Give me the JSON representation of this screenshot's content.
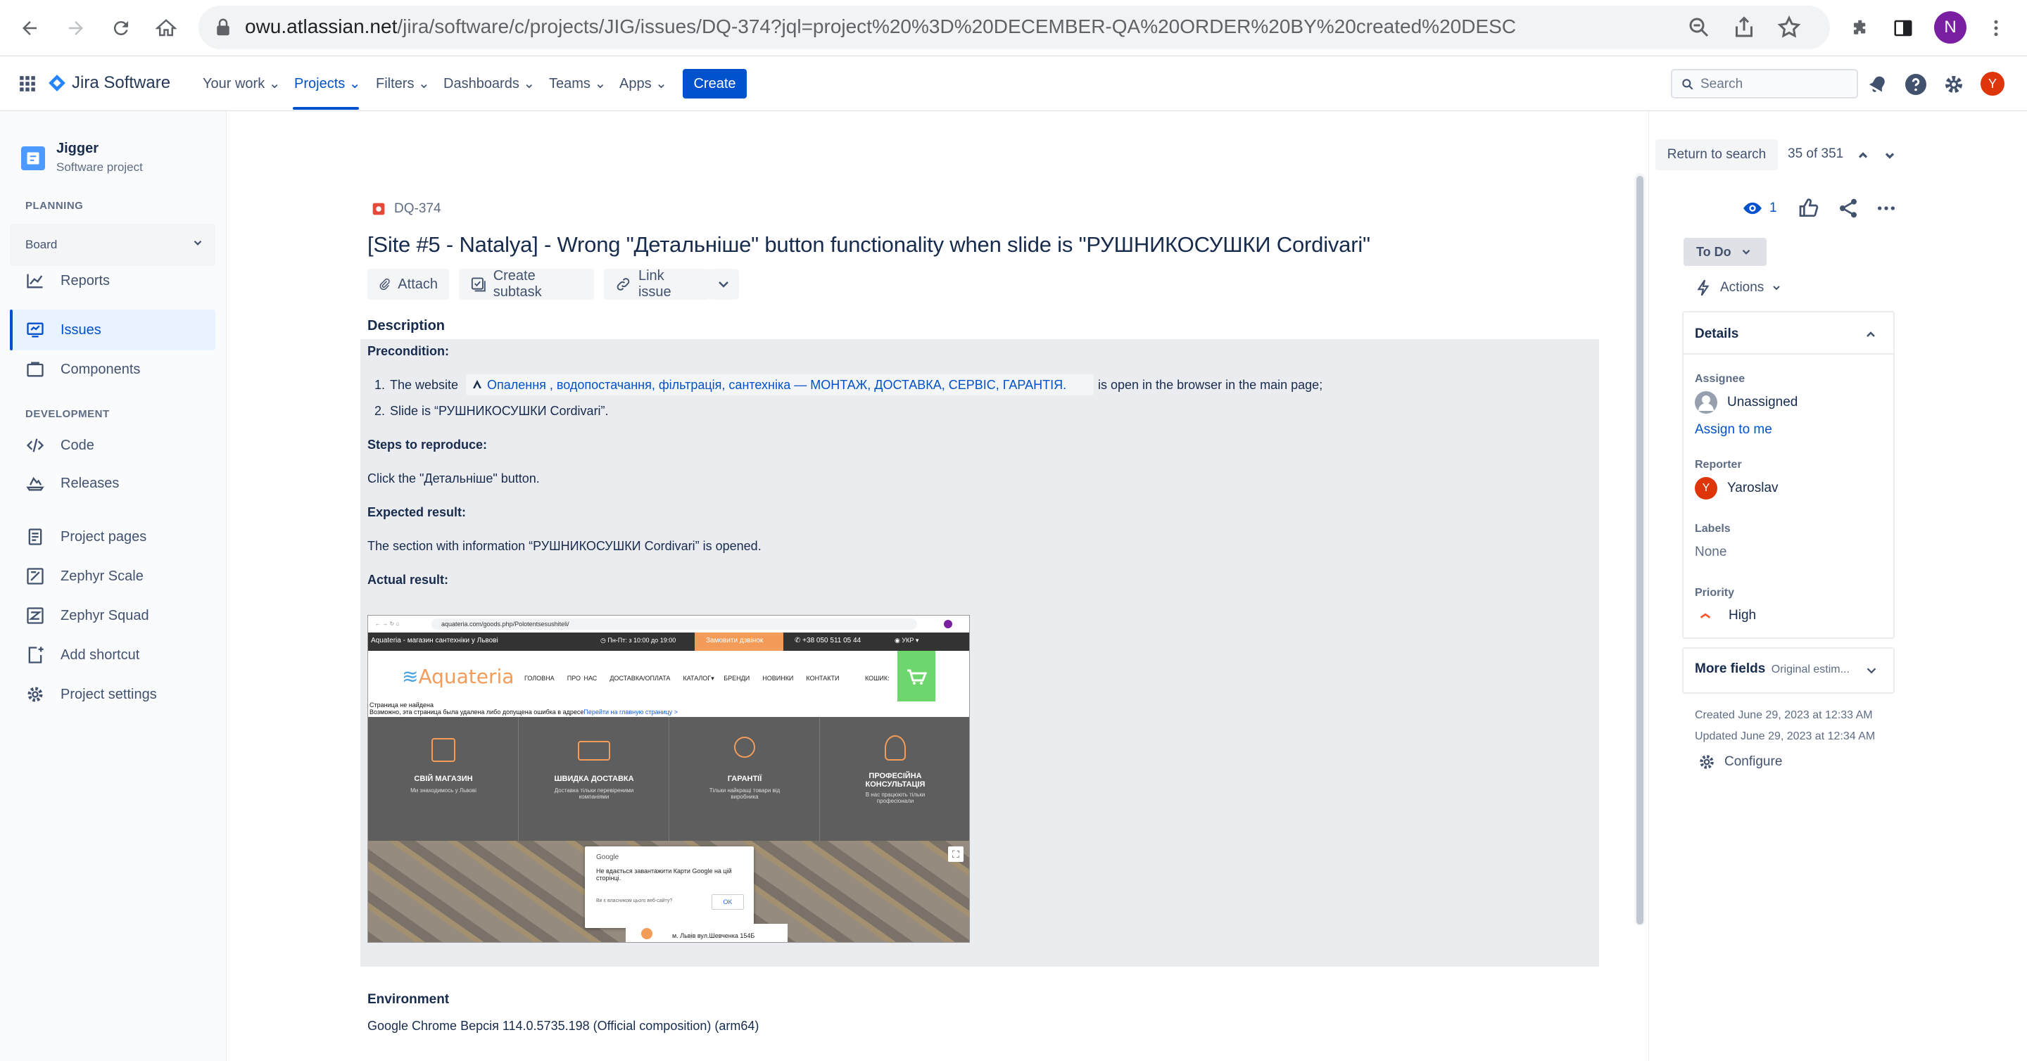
{
  "browser": {
    "url_host": "owu.atlassian.net",
    "url_path": "/jira/software/c/projects/JIG/issues/DQ-374?jql=project%20%3D%20DECEMBER-QA%20ORDER%20BY%20created%20DESC",
    "profile_initial": "N"
  },
  "topnav": {
    "product": "Jira Software",
    "items": [
      "Your work",
      "Projects",
      "Filters",
      "Dashboards",
      "Teams",
      "Apps"
    ],
    "create": "Create",
    "search_placeholder": "Search",
    "avatar_initial": "Y"
  },
  "sidebar": {
    "project_name": "Jigger",
    "project_type": "Software project",
    "planning_head": "PLANNING",
    "board": "Board",
    "reports": "Reports",
    "issues": "Issues",
    "components": "Components",
    "development_head": "DEVELOPMENT",
    "code": "Code",
    "releases": "Releases",
    "project_pages": "Project pages",
    "zephyr_scale": "Zephyr Scale",
    "zephyr_squad": "Zephyr Squad",
    "add_shortcut": "Add shortcut",
    "project_settings": "Project settings"
  },
  "issue": {
    "key": "DQ-374",
    "title": "[Site #5 - Natalya] - Wrong \"Детальніше\" button functionality when slide is \"РУШНИКОСУШКИ Cordivari\"",
    "attach": "Attach",
    "create_subtask": "Create subtask",
    "link_issue": "Link issue",
    "description_label": "Description",
    "precondition": "Precondition:",
    "pre1_a": "The website",
    "pre1_link": "Опалення , водопостачання, фільтрація, сантехніка — МОНТАЖ, ДОСТАВКА, СЕРВІС, ГАРАНТІЯ.",
    "pre1_b": "is open in the browser in the main page;",
    "pre2": "Slide is “РУШНИКОСУШКИ Cordivari”.",
    "steps_label": "Steps to reproduce:",
    "steps": "Click the \"Детальніше\" button.",
    "expected_label": "Expected result:",
    "expected": "The section with information “РУШНИКОСУШКИ Cordivari” is opened.",
    "actual_label": "Actual result:",
    "environment_label": "Environment",
    "environment": "Google Chrome Версія 114.0.5735.198 (Official composition) (arm64)"
  },
  "screenshot": {
    "url": "aquateria.com/goods.php/Polotentsesushiteli/",
    "tab_title": "Aquateria - магазин сантехніки у Львові",
    "hours": "Пн-Пт: з 10:00 до 19:00",
    "callback": "Замовити дзвінок",
    "phone": "+38 050 511 05 44",
    "lang": "УКР",
    "logo": "Aquateria",
    "menu": [
      "ГОЛОВНА",
      "ПРО НАС",
      "ДОСТАВКА/ОПЛАТА",
      "КАТАЛОГ",
      "БРЕНДИ",
      "НОВИНКИ",
      "КОНТАКТИ"
    ],
    "cart": "КОШИК:",
    "notfound1": "Страница не найдена",
    "notfound2": "Возможно, эта страница была удалена либо допущена ошибка в адресе",
    "notfound_link": "Перейти на главную страницу >",
    "features": [
      {
        "title": "СВІЙ МАГАЗИН",
        "sub": "Ми знаходимось у Львові"
      },
      {
        "title": "ШВИДКА ДОСТАВКА",
        "sub": "Доставка тільки перевіреними компаніями"
      },
      {
        "title": "ГАРАНТІЇ",
        "sub": "Тільки найкращі товари від виробника"
      },
      {
        "title": "ПРОФЕСІЙНА КОНСУЛЬТАЦІЯ",
        "sub": "В нас працюють тільки професіонали"
      }
    ],
    "maps_brand": "Google",
    "maps_error": "Не вдається завантажити Карти Google на цій сторінці.",
    "maps_question": "Ви є власником цього веб-сайту?",
    "maps_ok": "OK",
    "address": "м. Львів вул.Шевченка 154Б"
  },
  "right": {
    "return": "Return to search",
    "counter": "35 of 351",
    "watchers": "1",
    "status": "To Do",
    "actions": "Actions",
    "details": "Details",
    "assignee_label": "Assignee",
    "assignee": "Unassigned",
    "assign_me": "Assign to me",
    "reporter_label": "Reporter",
    "reporter": "Yaroslav",
    "reporter_initial": "Y",
    "labels_label": "Labels",
    "labels": "None",
    "priority_label": "Priority",
    "priority": "High",
    "more_fields": "More fields",
    "more_fields_sub": "Original estim...",
    "created": "Created June 29, 2023 at 12:33 AM",
    "updated": "Updated June 29, 2023 at 12:34 AM",
    "configure": "Configure"
  },
  "colors": {
    "brand": "#0052cc",
    "link": "#0052cc",
    "priority_high": "#ff5630",
    "issue_type": "#e5493a"
  }
}
